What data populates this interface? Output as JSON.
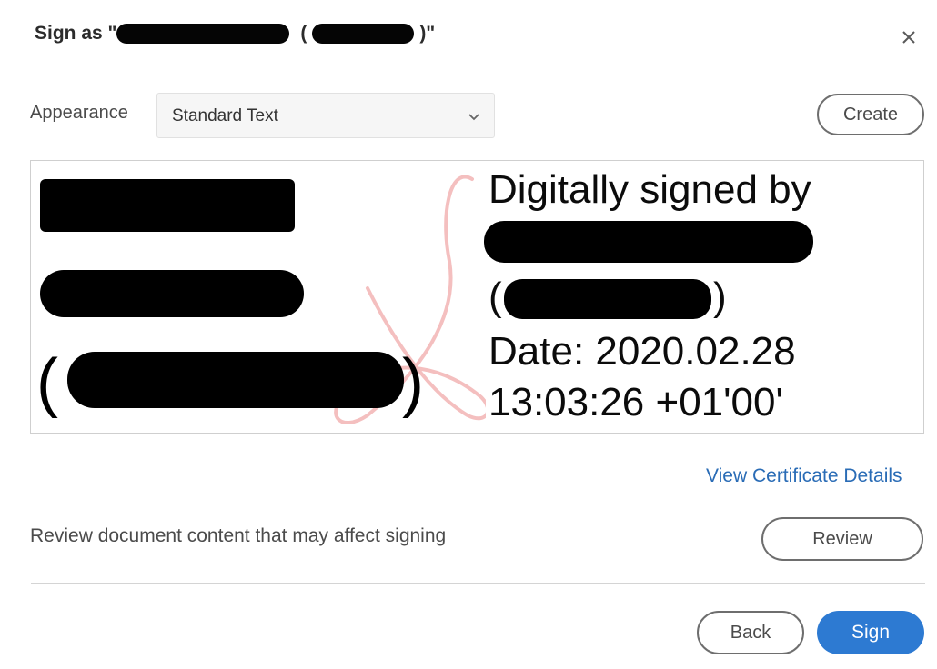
{
  "dialog": {
    "title_prefix": "Sign as \"",
    "title_middle": " (",
    "title_suffix": ")\"",
    "close_icon": "close-icon"
  },
  "appearance": {
    "label": "Appearance",
    "selected": "Standard Text",
    "create_label": "Create"
  },
  "preview": {
    "paren_open": "(",
    "paren_close": ")",
    "signed_by": "Digitally signed by",
    "date_line": "Date: 2020.02.28",
    "time_line": "13:03:26 +01'00'"
  },
  "certificate_link": "View Certificate Details",
  "review": {
    "text": "Review document content that may affect signing",
    "button_label": "Review"
  },
  "footer": {
    "back_label": "Back",
    "sign_label": "Sign"
  },
  "colors": {
    "primary": "#2d7ad2",
    "link": "#2a6cb6",
    "watermark": "#f3b8b8"
  }
}
